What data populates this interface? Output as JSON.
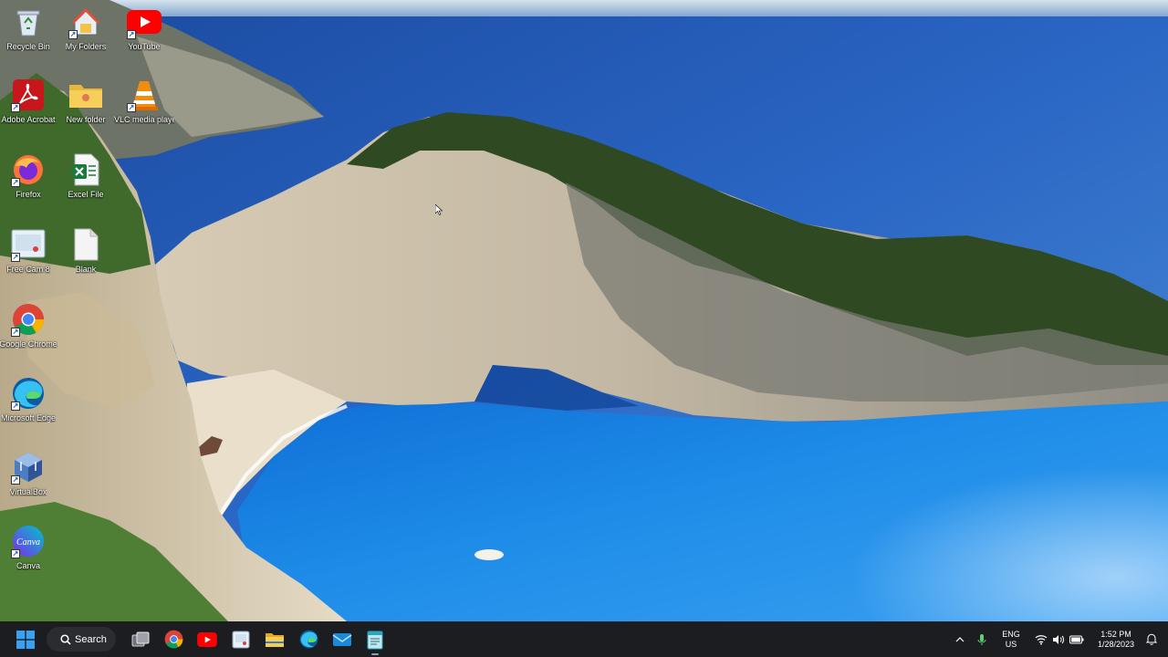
{
  "desktop": {
    "icons": [
      {
        "label": "Recycle Bin",
        "icon": "recycle-bin-icon",
        "shortcut": false
      },
      {
        "label": "My Folders",
        "icon": "home-folder-icon",
        "shortcut": true
      },
      {
        "label": "YouTube",
        "icon": "youtube-icon",
        "shortcut": true
      },
      {
        "label": "Adobe Acrobat",
        "icon": "adobe-acrobat-icon",
        "shortcut": true
      },
      {
        "label": "New folder",
        "icon": "folder-icon",
        "shortcut": false
      },
      {
        "label": "VLC media player",
        "icon": "vlc-icon",
        "shortcut": true
      },
      {
        "label": "Firefox",
        "icon": "firefox-icon",
        "shortcut": true
      },
      {
        "label": "Excel File",
        "icon": "excel-icon",
        "shortcut": false
      },
      {
        "label": "Free Cam 8",
        "icon": "freecam-icon",
        "shortcut": true
      },
      {
        "label": "Blank",
        "icon": "blank-file-icon",
        "shortcut": false
      },
      {
        "label": "Google Chrome",
        "icon": "chrome-icon",
        "shortcut": true
      },
      {
        "label": "Microsoft Edge",
        "icon": "edge-icon",
        "shortcut": true
      },
      {
        "label": "VirtualBox",
        "icon": "virtualbox-icon",
        "shortcut": true
      },
      {
        "label": "Canva",
        "icon": "canva-icon",
        "shortcut": true
      }
    ]
  },
  "taskbar": {
    "search_label": "Search",
    "pinned": [
      {
        "name": "start-button",
        "icon": "windows-logo-icon"
      },
      {
        "name": "task-view-button",
        "icon": "task-view-icon"
      },
      {
        "name": "taskbar-chrome",
        "icon": "chrome-icon"
      },
      {
        "name": "taskbar-youtube",
        "icon": "youtube-icon"
      },
      {
        "name": "taskbar-freecam",
        "icon": "freecam-icon"
      },
      {
        "name": "taskbar-file-explorer",
        "icon": "file-explorer-icon"
      },
      {
        "name": "taskbar-edge",
        "icon": "edge-icon"
      },
      {
        "name": "taskbar-mail",
        "icon": "mail-icon"
      },
      {
        "name": "taskbar-notepad",
        "icon": "notepad-icon"
      }
    ],
    "tray": {
      "language_line1": "ENG",
      "language_line2": "US",
      "time": "1:52 PM",
      "date": "1/28/2023",
      "icons": [
        "chevron-up-icon",
        "microphone-icon",
        "wifi-icon",
        "volume-icon",
        "battery-icon",
        "notification-icon"
      ]
    }
  },
  "colors": {
    "taskbar_bg": "#1c1d21",
    "accent": "#0078d4"
  }
}
